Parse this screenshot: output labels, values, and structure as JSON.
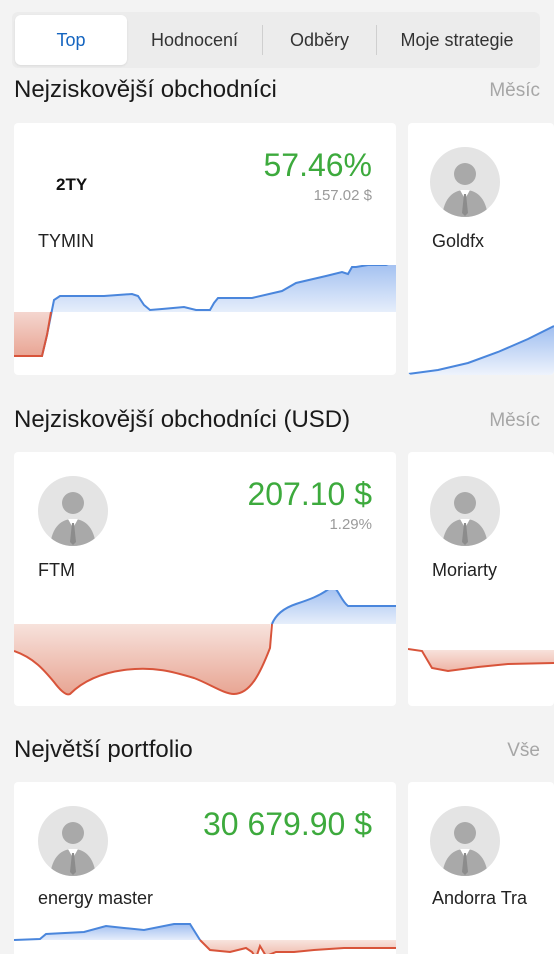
{
  "tabs": [
    {
      "label": "Top",
      "active": true
    },
    {
      "label": "Hodnocení",
      "active": false
    },
    {
      "label": "Odběry",
      "active": false
    },
    {
      "label": "Moje strategie",
      "active": false
    }
  ],
  "sections": [
    {
      "title": "Nejziskovější obchodníci",
      "link": "Měsíc",
      "cards": [
        {
          "name": "TYMIN",
          "logo_text": "2TY",
          "value": "57.46%",
          "sub": "157.02 $"
        },
        {
          "name": "Goldfx"
        }
      ]
    },
    {
      "title": "Nejziskovější obchodníci (USD)",
      "link": "Měsíc",
      "cards": [
        {
          "name": "FTM",
          "value": "207.10 $",
          "sub": "1.29%"
        },
        {
          "name": "Moriarty"
        }
      ]
    },
    {
      "title": "Největší portfolio",
      "link": "Vše",
      "cards": [
        {
          "name": "energy master",
          "value": "30 679.90 $"
        },
        {
          "name": "Andorra Tra"
        }
      ]
    }
  ],
  "colors": {
    "accent_blue": "#1565c0",
    "profit_green": "#3daa3d",
    "chart_up": "#4a86dc",
    "chart_down": "#d8543a"
  }
}
